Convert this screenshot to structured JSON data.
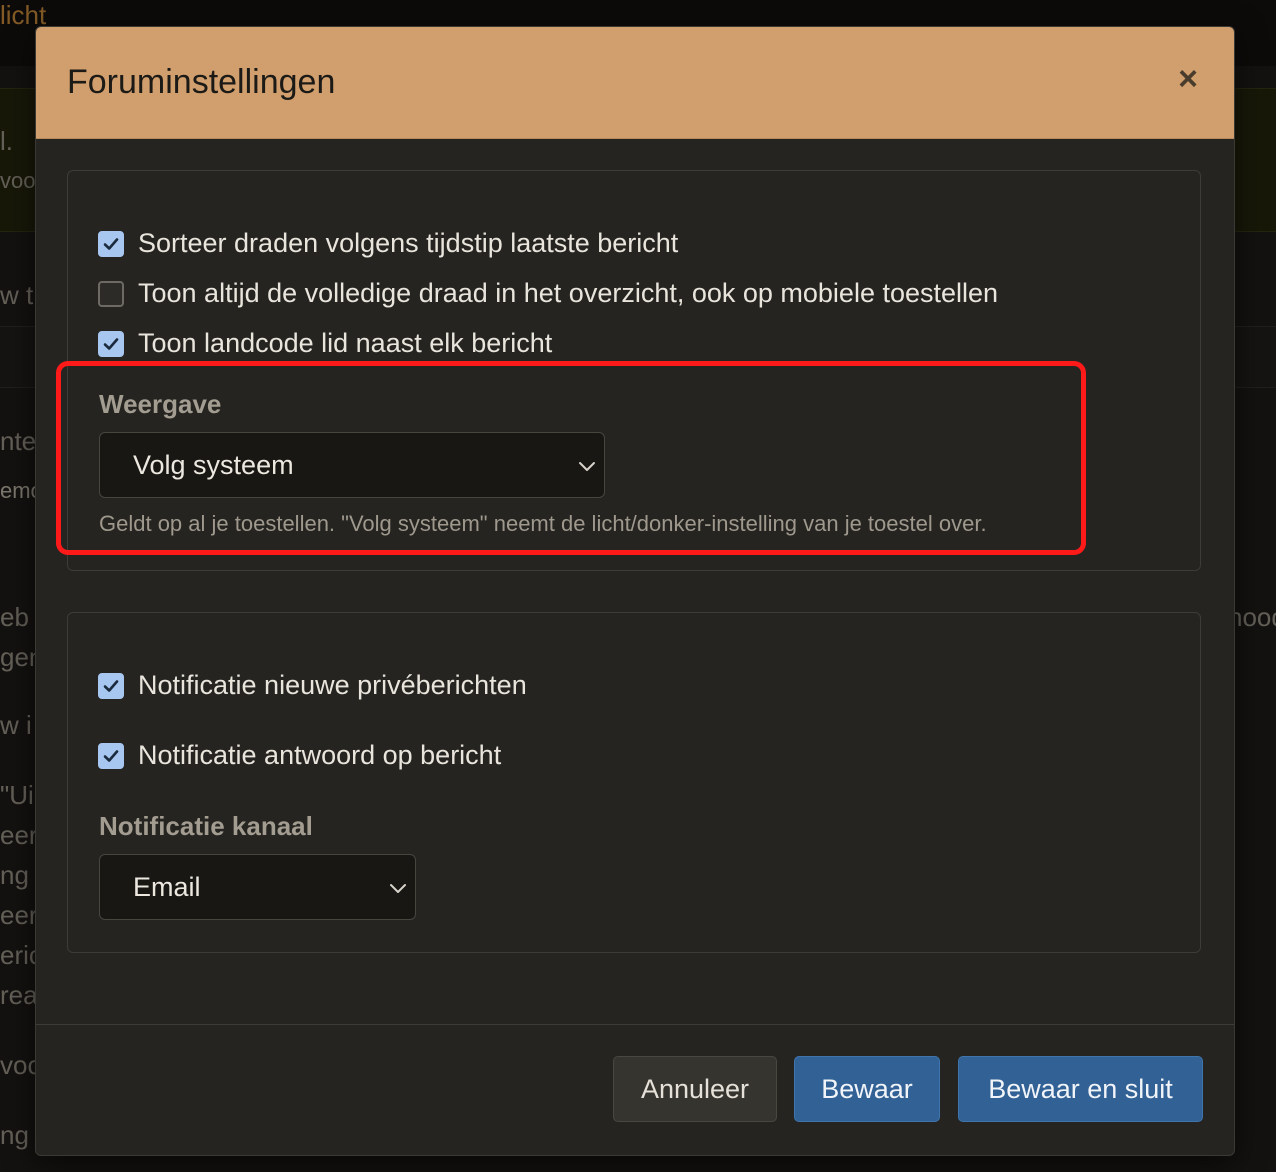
{
  "background": {
    "fragments": [
      "licht",
      "l.",
      "voo",
      "w t",
      "nte",
      "emo",
      "eb",
      "gen",
      "w i",
      "\"Ui",
      "eer",
      "ng",
      "eer",
      "eric",
      "rea",
      "voo",
      "ng",
      "nood"
    ]
  },
  "modal": {
    "title": "Foruminstellingen",
    "close_icon": "×",
    "display_settings": {
      "checkboxes": [
        {
          "label": "Sorteer draden volgens tijdstip laatste bericht",
          "checked": true
        },
        {
          "label": "Toon altijd de volledige draad in het overzicht, ook op mobiele toestellen",
          "checked": false
        },
        {
          "label": "Toon landcode lid naast elk bericht",
          "checked": true
        }
      ],
      "appearance": {
        "label": "Weergave",
        "selected": "Volg systeem",
        "help": "Geldt op al je toestellen. \"Volg systeem\" neemt de licht/donker-instelling van je toestel over."
      }
    },
    "notification_settings": {
      "checkboxes": [
        {
          "label": "Notificatie nieuwe privéberichten",
          "checked": true
        },
        {
          "label": "Notificatie antwoord op bericht",
          "checked": true
        }
      ],
      "channel": {
        "label": "Notificatie kanaal",
        "selected": "Email"
      }
    },
    "footer": {
      "cancel": "Annuleer",
      "save": "Bewaar",
      "save_close": "Bewaar en sluit"
    }
  },
  "colors": {
    "header": "#d19f6d",
    "primary_button": "#316195",
    "checkbox_checked": "#a8c7f0",
    "highlight": "#ff1a1a"
  }
}
